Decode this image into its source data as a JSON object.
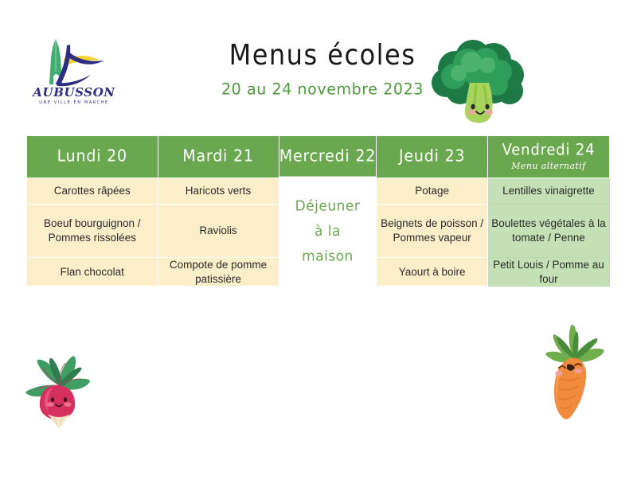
{
  "page": {
    "title": "Menus écoles",
    "date_range": "20 au 24 novembre 2023",
    "background_color": "#ffffff"
  },
  "logo": {
    "name": "AUBUSSON",
    "tagline": "UNE VILLE EN MARCHE",
    "colors": {
      "navy": "#2d2e83",
      "yellow": "#f4d32a",
      "green": "#3fae6f"
    }
  },
  "illustrations": [
    {
      "name": "broccoli-illustration",
      "label": "Brocoli",
      "colors": {
        "dark_green": "#1e7a45",
        "mid_green": "#2f9e5a",
        "light_green": "#8cc63f",
        "stem": "#a8d45e",
        "cheek": "#f2a0a8"
      }
    },
    {
      "name": "radish-illustration",
      "label": "Radis",
      "colors": {
        "leaf_dark": "#2f7d4f",
        "leaf_mid": "#3f9e63",
        "body": "#d6315e",
        "body_light": "#e5557c",
        "root": "#f7e6c8",
        "cheek": "#f2a0a8"
      }
    },
    {
      "name": "carrot-illustration",
      "label": "Carotte",
      "colors": {
        "leaf_dark": "#4a8c3a",
        "leaf_mid": "#6fae4b",
        "body": "#f08a3c",
        "body_light": "#f79a50",
        "cheek": "#f2a0a8"
      }
    }
  ],
  "colors": {
    "header_green": "#6aa84f",
    "cell_cream": "#fbeec9",
    "cell_light_green": "#c5e0b4",
    "accent_green_text": "#4e9a3f",
    "text_dark": "#2b2b2b",
    "white": "#ffffff"
  },
  "table": {
    "columns": [
      {
        "key": "lundi",
        "day": "Lundi 20",
        "note": ""
      },
      {
        "key": "mardi",
        "day": "Mardi 21",
        "note": ""
      },
      {
        "key": "mercredi",
        "day": "Mercredi 22",
        "note": ""
      },
      {
        "key": "jeudi",
        "day": "Jeudi 23",
        "note": ""
      },
      {
        "key": "vendredi",
        "day": "Vendredi 24",
        "note": "Menu alternatif"
      }
    ],
    "mercredi_merged_cell": "Déjeuner\nà la\nmaison",
    "mercredi_merged_lines": {
      "line1": "Déjeuner",
      "line2": "à la",
      "line3": "maison"
    },
    "rows": [
      {
        "key": "entree",
        "cells": {
          "lundi": "Carottes râpées",
          "mardi": "Haricots verts",
          "jeudi": "Potage",
          "vendredi": "Lentilles vinaigrette"
        }
      },
      {
        "key": "plat",
        "cells": {
          "lundi": "Boeuf bourguignon / Pommes rissolées",
          "mardi": "Raviolis",
          "jeudi": "Beignets de poisson / Pommes vapeur",
          "vendredi": "Boulettes végétales à la tomate / Penne"
        }
      },
      {
        "key": "dessert",
        "cells": {
          "lundi": "Flan chocolat",
          "mardi": "Compote de pomme patissière",
          "jeudi": "Yaourt à boire",
          "vendredi": "Petit Louis / Pomme au four"
        }
      }
    ]
  }
}
